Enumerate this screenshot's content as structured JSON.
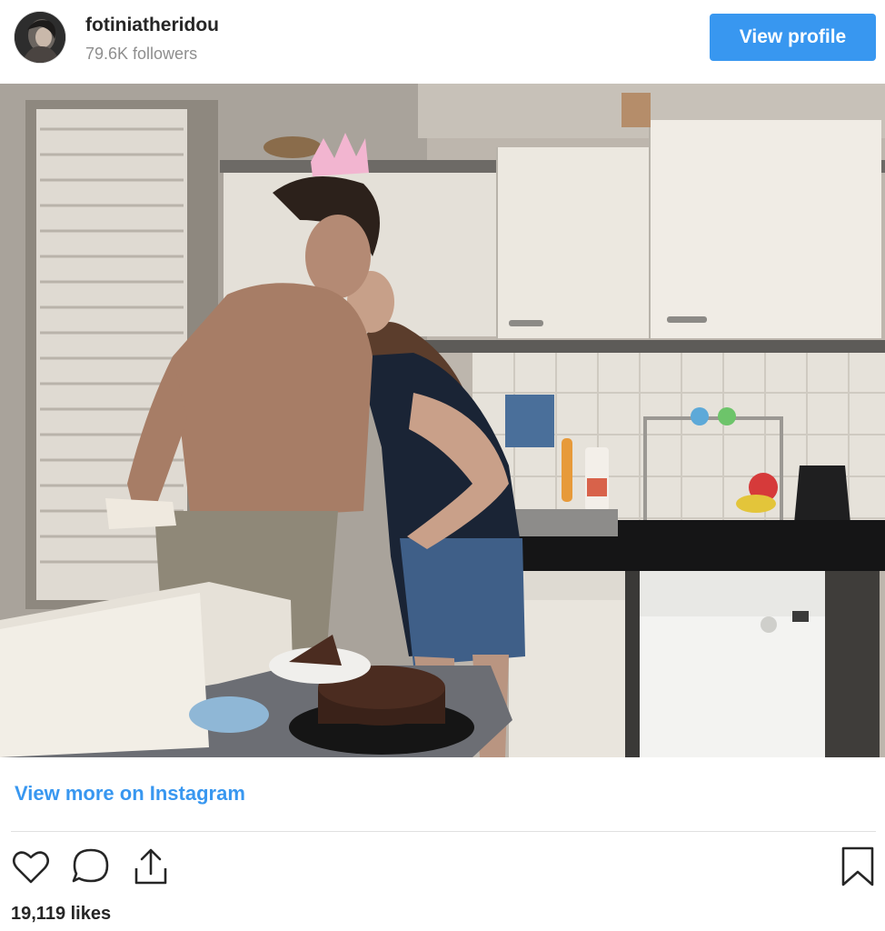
{
  "header": {
    "username": "fotiniatheridou",
    "followers": "79.6K followers",
    "view_profile_label": "View profile"
  },
  "post": {
    "image_alt": "A couple kissing in a kitchen next to a chocolate cake"
  },
  "footer": {
    "view_more_label": "View more on Instagram",
    "likes": "19,119 likes"
  },
  "icons": {
    "like": "heart-icon",
    "comment": "comment-icon",
    "share": "share-icon",
    "save": "bookmark-icon"
  },
  "colors": {
    "accent": "#3897f0",
    "text": "#262626",
    "muted": "#8e8e8e"
  }
}
